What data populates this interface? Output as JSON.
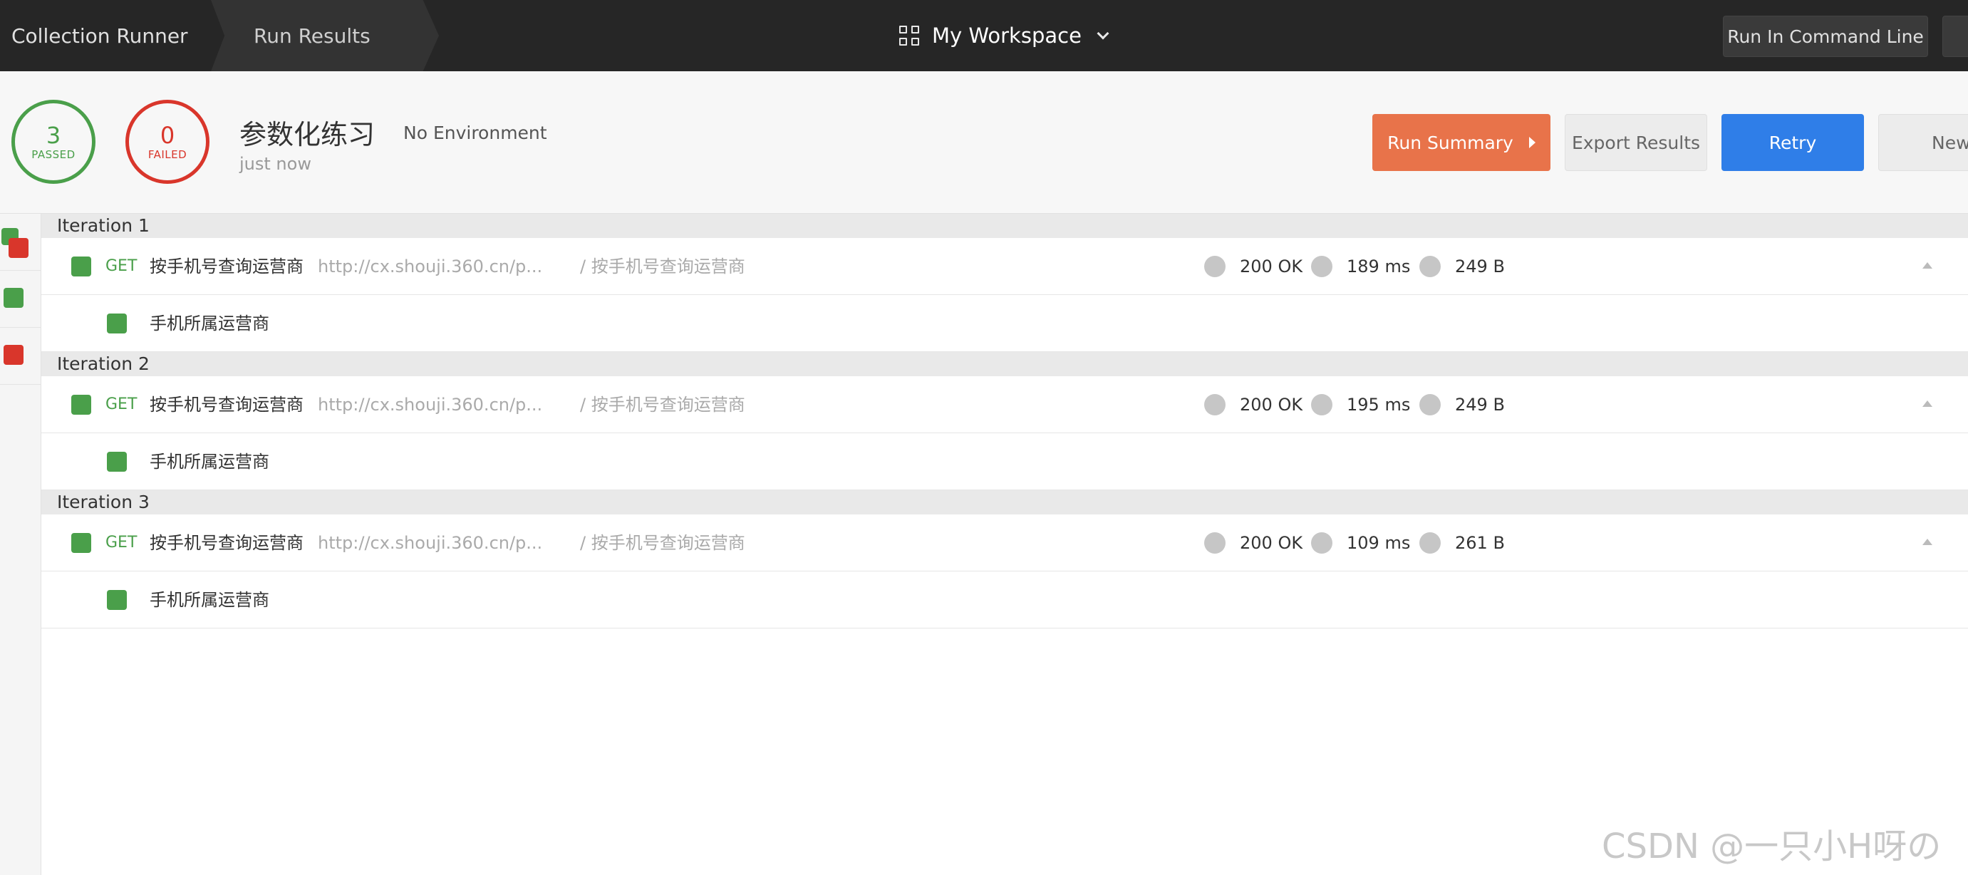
{
  "topbar": {
    "crumb_first": "Collection Runner",
    "crumb_second": "Run Results",
    "workspace": "My Workspace",
    "run_cli_label": "Run In Command Line"
  },
  "summary": {
    "passed_count": "3",
    "passed_label": "PASSED",
    "failed_count": "0",
    "failed_label": "FAILED",
    "collection_name": "参数化练习",
    "environment": "No Environment",
    "time_ago": "just now",
    "run_summary_label": "Run Summary",
    "export_label": "Export Results",
    "retry_label": "Retry",
    "new_label": "New"
  },
  "iterations": [
    {
      "label": "Iteration 1",
      "request": {
        "method": "GET",
        "name": "按手机号查询运营商",
        "url": "http://cx.shouji.360.cn/p...",
        "path": "/ 按手机号查询运营商",
        "status": "200 OK",
        "time": "189 ms",
        "size": "249 B"
      },
      "test": "手机所属运营商"
    },
    {
      "label": "Iteration 2",
      "request": {
        "method": "GET",
        "name": "按手机号查询运营商",
        "url": "http://cx.shouji.360.cn/p...",
        "path": "/ 按手机号查询运营商",
        "status": "200 OK",
        "time": "195 ms",
        "size": "249 B"
      },
      "test": "手机所属运营商"
    },
    {
      "label": "Iteration 3",
      "request": {
        "method": "GET",
        "name": "按手机号查询运营商",
        "url": "http://cx.shouji.360.cn/p...",
        "path": "/ 按手机号查询运营商",
        "status": "200 OK",
        "time": "109 ms",
        "size": "261 B"
      },
      "test": "手机所属运营商"
    }
  ],
  "watermark": "CSDN @一只小H呀の",
  "colors": {
    "passed": "#4a9f4a",
    "failed": "#d9362b",
    "run_summary": "#e8734a",
    "retry": "#2f7ee8",
    "topbar": "#262626"
  }
}
